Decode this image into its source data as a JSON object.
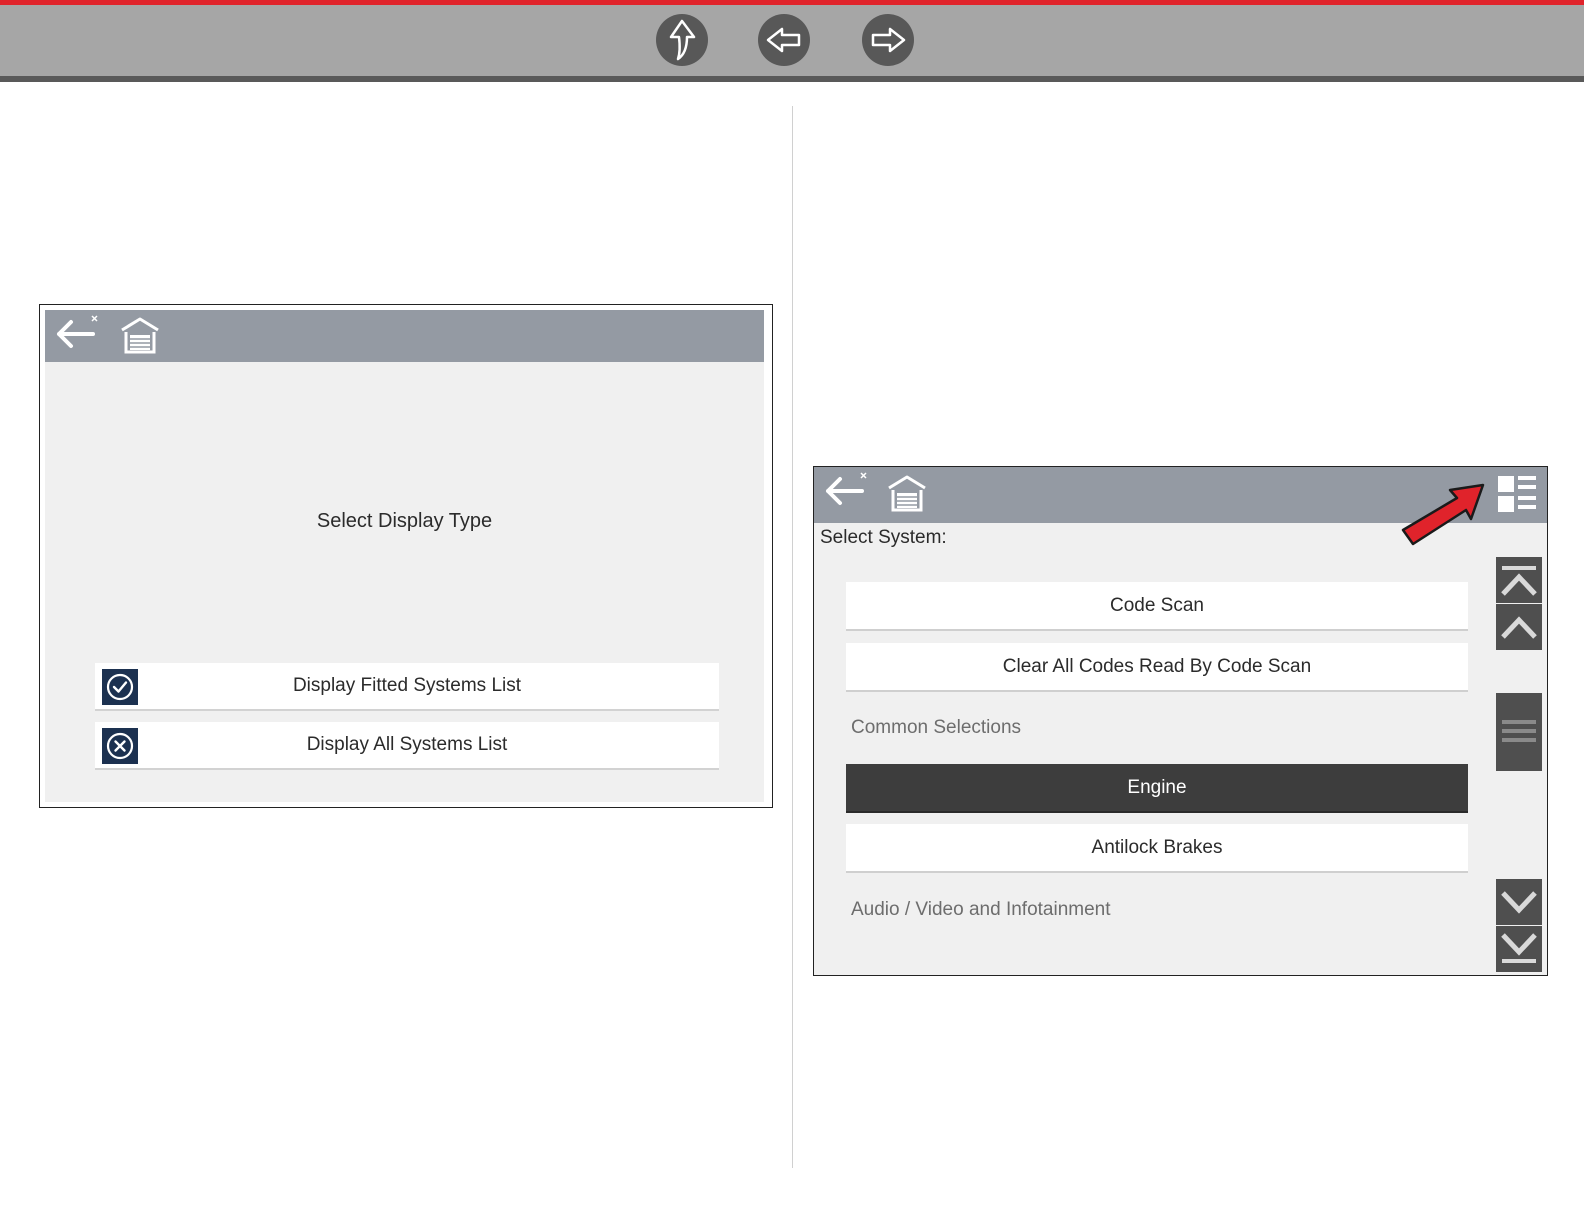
{
  "top_nav": {
    "buttons": [
      {
        "name": "up-icon"
      },
      {
        "name": "back-icon"
      },
      {
        "name": "forward-icon"
      }
    ],
    "accent_color": "#e0232b"
  },
  "left_screen": {
    "header_icons": [
      "back-exit-icon",
      "home-garage-icon"
    ],
    "title": "Select Display Type",
    "options": [
      {
        "label": "Display Fitted Systems List",
        "icon": "check-circle-icon"
      },
      {
        "label": "Display All Systems List",
        "icon": "x-circle-icon"
      }
    ]
  },
  "right_screen": {
    "header_icons": [
      "back-exit-icon",
      "home-garage-icon",
      "view-toggle-icon"
    ],
    "select_label": "Select System:",
    "rows": [
      {
        "label": "Code Scan",
        "kind": "button"
      },
      {
        "label": "Clear All Codes Read By Code Scan",
        "kind": "button"
      },
      {
        "label": "Common Selections",
        "kind": "section"
      },
      {
        "label": "Engine",
        "kind": "button",
        "selected": true
      },
      {
        "label": "Antilock Brakes",
        "kind": "button"
      },
      {
        "label": "Audio / Video and Infotainment",
        "kind": "section"
      }
    ],
    "scrollbar_icons": [
      "scroll-top-icon",
      "scroll-up-icon",
      "scroll-thumb-icon",
      "scroll-down-icon",
      "scroll-bottom-icon"
    ],
    "callout": "red-arrow-pointer-icon"
  }
}
